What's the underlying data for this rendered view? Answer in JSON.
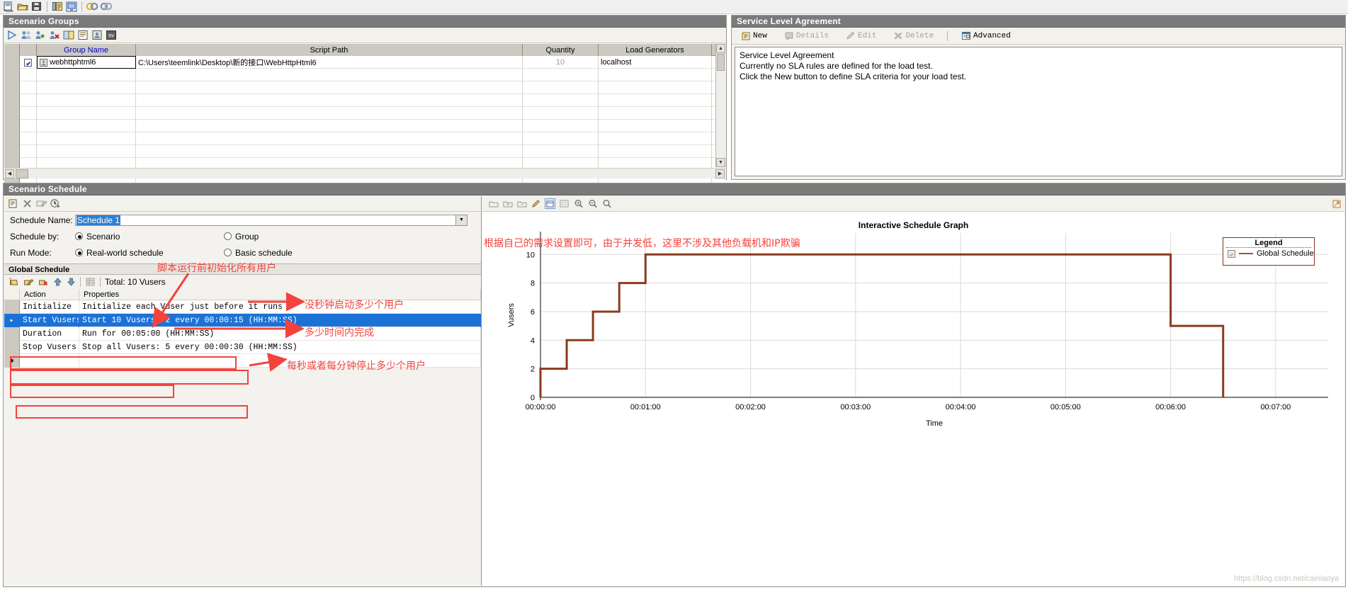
{
  "app_toolbar": {
    "icons": [
      "new-scenario-icon",
      "open-icon",
      "save-icon",
      "results-icon",
      "monitor-icon",
      "connect-icon",
      "disconnect-icon"
    ]
  },
  "scenario_groups": {
    "title": "Scenario Groups",
    "toolbar_icons": [
      "run-icon",
      "vusers-icon",
      "add-group-icon",
      "remove-group-icon",
      "copy-group-icon",
      "details-icon",
      "generator-icon",
      "summary-icon"
    ],
    "columns": [
      "",
      "",
      "Group Name",
      "Script Path",
      "Quantity",
      "Load Generators"
    ],
    "rows": [
      {
        "checked": true,
        "group_name": "webhttphtml6",
        "script_path": "C:\\Users\\teemlink\\Desktop\\新的接口\\WebHttpHtml6",
        "quantity": "10",
        "load_generators": "localhost"
      }
    ],
    "empty_row_count": 9
  },
  "sla": {
    "title": "Service Level Agreement",
    "buttons": [
      {
        "label": "New",
        "enabled": true,
        "icon": "new-sla-icon"
      },
      {
        "label": "Details",
        "enabled": false,
        "icon": "details-icon"
      },
      {
        "label": "Edit",
        "enabled": false,
        "icon": "pencil-icon"
      },
      {
        "label": "Delete",
        "enabled": false,
        "icon": "delete-x-icon"
      },
      {
        "label": "Advanced",
        "enabled": true,
        "icon": "advanced-icon"
      }
    ],
    "body_lines": [
      "Service Level Agreement",
      "Currently no SLA rules are defined for the load test.",
      "Click the New button to define SLA criteria for your load test."
    ]
  },
  "scenario_schedule": {
    "title": "Scenario Schedule",
    "toolbar_icons": [
      "new-schedule-icon",
      "delete-schedule-icon",
      "rename-schedule-icon",
      "run-schedule-icon"
    ],
    "schedule_name_label": "Schedule Name:",
    "schedule_name_value": "Schedule 1",
    "schedule_by_label": "Schedule by:",
    "schedule_by_options": [
      {
        "label": "Scenario",
        "selected": true
      },
      {
        "label": "Group",
        "selected": false
      }
    ],
    "run_mode_label": "Run Mode:",
    "run_mode_options": [
      {
        "label": "Real-world schedule",
        "selected": true
      },
      {
        "label": "Basic schedule",
        "selected": false
      }
    ],
    "global_schedule": {
      "title": "Global Schedule",
      "toolbar_icons": [
        "add-action-icon",
        "edit-action-icon",
        "remove-action-icon",
        "move-up-icon",
        "move-down-icon",
        "grid-icon"
      ],
      "total_label": "Total: 10 Vusers",
      "columns": [
        "Action",
        "Properties"
      ],
      "rows": [
        {
          "selected": false,
          "marker": "",
          "action": "Initialize",
          "properties": "Initialize each Vuser just before it runs"
        },
        {
          "selected": true,
          "marker": "▸",
          "action": "Start  Vusers",
          "properties": "Start 10 Vusers: 2 every 00:00:15 (HH:MM:SS)"
        },
        {
          "selected": false,
          "marker": "",
          "action": "Duration",
          "properties": "Run for 00:05:00 (HH:MM:SS)"
        },
        {
          "selected": false,
          "marker": "",
          "action": "Stop Vusers",
          "properties": "Stop all Vusers: 5 every 00:00:30 (HH:MM:SS)"
        },
        {
          "selected": false,
          "marker": "✱",
          "action": "",
          "properties": ""
        }
      ]
    }
  },
  "graph_panel": {
    "toolbar_icons": [
      "show-icon",
      "zoom-in-area-icon",
      "zoom-out-area-icon",
      "pencil-icon",
      "select-mode-icon",
      "grid-mode-icon",
      "magnify-icon",
      "shrink-icon",
      "reset-zoom-icon"
    ],
    "right_edge_icon": "expand-icon"
  },
  "chart_data": {
    "type": "line",
    "title": "Interactive Schedule Graph",
    "xlabel": "Time",
    "ylabel": "Vusers",
    "xticks": [
      "00:00:00",
      "00:01:00",
      "00:02:00",
      "00:03:00",
      "00:04:00",
      "00:05:00",
      "00:06:00",
      "00:07:00"
    ],
    "yticks": [
      0,
      2,
      4,
      6,
      8,
      10
    ],
    "ylim": [
      0,
      11.5
    ],
    "xlim_seconds": [
      0,
      450
    ],
    "grid": true,
    "legend_position": "top-right",
    "legend_title": "Legend",
    "series": [
      {
        "name": "Global Schedule",
        "color": "#8c3a1d",
        "points_seconds_vusers": [
          [
            0,
            0
          ],
          [
            0,
            2
          ],
          [
            15,
            2
          ],
          [
            15,
            4
          ],
          [
            30,
            4
          ],
          [
            30,
            6
          ],
          [
            45,
            6
          ],
          [
            45,
            8
          ],
          [
            60,
            8
          ],
          [
            60,
            10
          ],
          [
            360,
            10
          ],
          [
            360,
            5
          ],
          [
            390,
            5
          ],
          [
            390,
            0
          ]
        ]
      }
    ]
  },
  "annotations": [
    {
      "id": "ann-init",
      "text": "脚本运行前初始化所有用户"
    },
    {
      "id": "ann-start",
      "text": "没秒钟启动多少个用户"
    },
    {
      "id": "ann-duration",
      "text": "多少时间内完成"
    },
    {
      "id": "ann-stop",
      "text": "每秒或者每分钟停止多少个用户"
    },
    {
      "id": "ann-graph",
      "text": "根据自己的需求设置即可，由于并发低，这里不涉及其他负载机和IP欺骗"
    }
  ],
  "watermark": "https://blog.csdn.net/cainiaoya"
}
